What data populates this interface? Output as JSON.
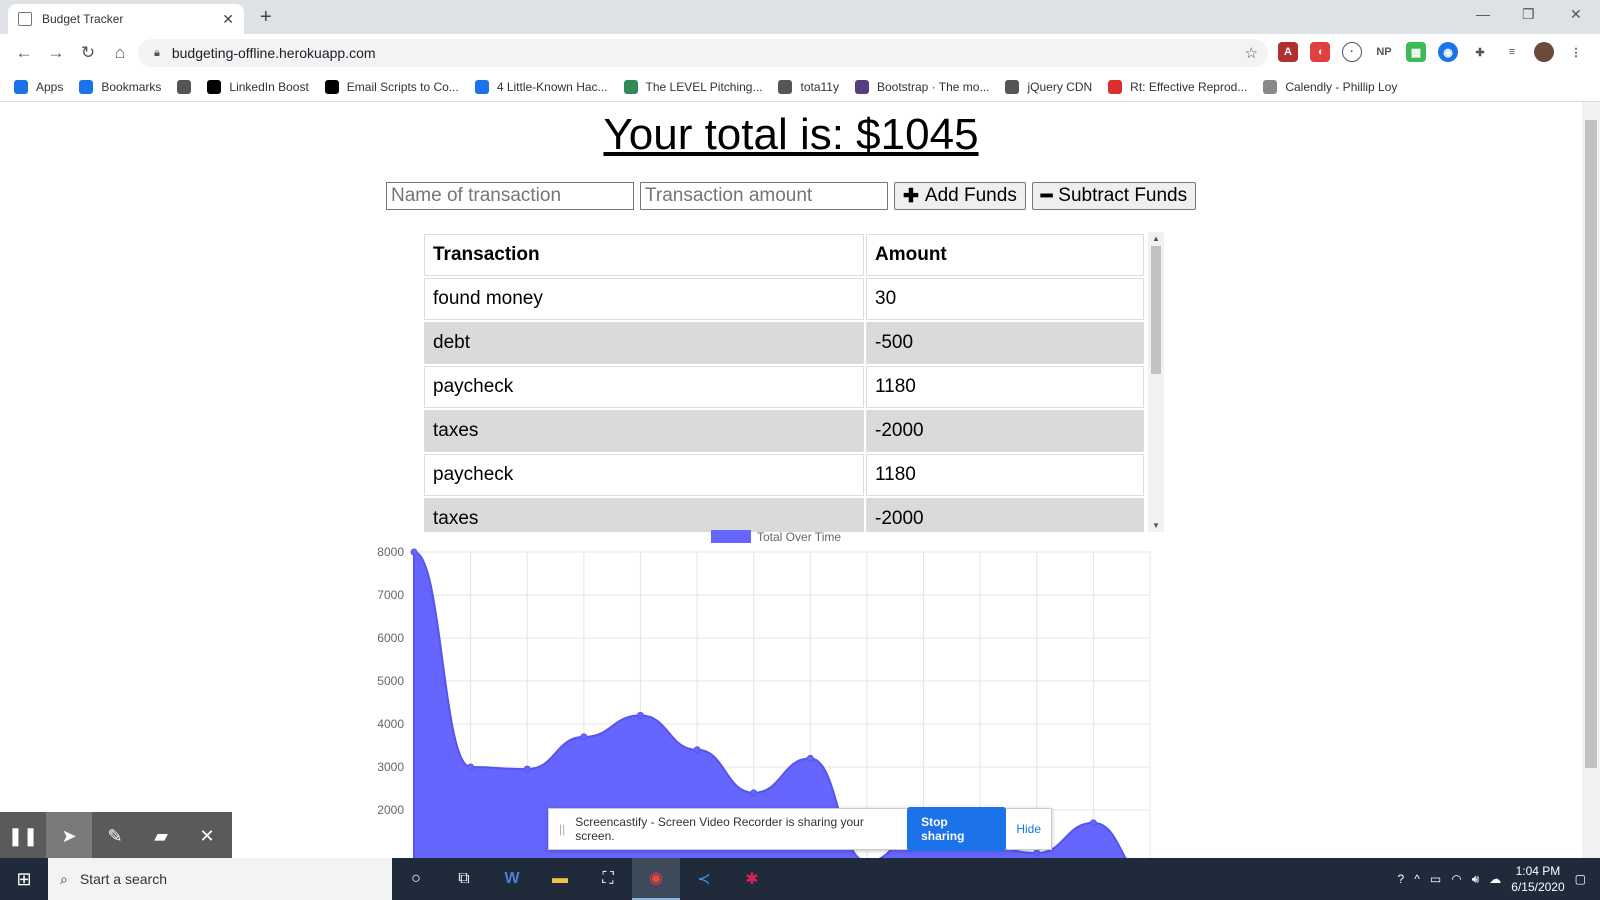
{
  "browser": {
    "tab_title": "Budget Tracker",
    "url": "budgeting-offline.herokuapp.com",
    "bookmarks": [
      {
        "label": "Apps",
        "icon": "apps-grid-icon",
        "color": "#1a73e8"
      },
      {
        "label": "Bookmarks",
        "icon": "star-icon",
        "color": "#1a73e8"
      },
      {
        "label": "",
        "icon": "globe-icon",
        "color": "#555555"
      },
      {
        "label": "LinkedIn Boost",
        "icon": "medium-m-icon",
        "color": "#000000"
      },
      {
        "label": "Email Scripts to Co...",
        "icon": "medium-m-icon",
        "color": "#000000"
      },
      {
        "label": "4 Little-Known Hac...",
        "icon": "swirl-icon",
        "color": "#1a73e8"
      },
      {
        "label": "The LEVEL Pitching...",
        "icon": "page-icon",
        "color": "#2e8b57"
      },
      {
        "label": "tota11y",
        "icon": "globe-icon",
        "color": "#555555"
      },
      {
        "label": "Bootstrap · The mo...",
        "icon": "bootstrap-icon",
        "color": "#563d7c"
      },
      {
        "label": "jQuery CDN",
        "icon": "globe-icon",
        "color": "#555555"
      },
      {
        "label": "Rt: Effective Reprod...",
        "icon": "bug-icon",
        "color": "#d9302c"
      },
      {
        "label": "Calendly - Phillip Loy",
        "icon": "calendar-icon",
        "color": "#888888"
      }
    ]
  },
  "app": {
    "total_text": "Your total is: $1045",
    "name_placeholder": "Name of transaction",
    "amount_placeholder": "Transaction amount",
    "add_label": "Add Funds",
    "subtract_label": "Subtract Funds",
    "table": {
      "headers": [
        "Transaction",
        "Amount"
      ],
      "rows": [
        [
          "found money",
          "30"
        ],
        [
          "debt",
          "-500"
        ],
        [
          "paycheck",
          "1180"
        ],
        [
          "taxes",
          "-2000"
        ],
        [
          "paycheck",
          "1180"
        ],
        [
          "taxes",
          "-2000"
        ]
      ]
    }
  },
  "chart_data": {
    "type": "area",
    "legend": "Total Over Time",
    "color": "#6666ff",
    "ylim": [
      1000,
      8000
    ],
    "yticks": [
      "8000",
      "7000",
      "6000",
      "5000",
      "4000",
      "3000",
      "2000"
    ],
    "values": [
      8000,
      3000,
      2950,
      3700,
      4200,
      3400,
      2400,
      3200,
      800,
      1600,
      1200,
      1000,
      1700,
      400
    ]
  },
  "overlay": {
    "share_text": "Screencastify - Screen Video Recorder is sharing your screen.",
    "stop_label": "Stop sharing",
    "hide_label": "Hide"
  },
  "taskbar": {
    "search_placeholder": "Start a search",
    "time": "1:04 PM",
    "date": "6/15/2020"
  }
}
